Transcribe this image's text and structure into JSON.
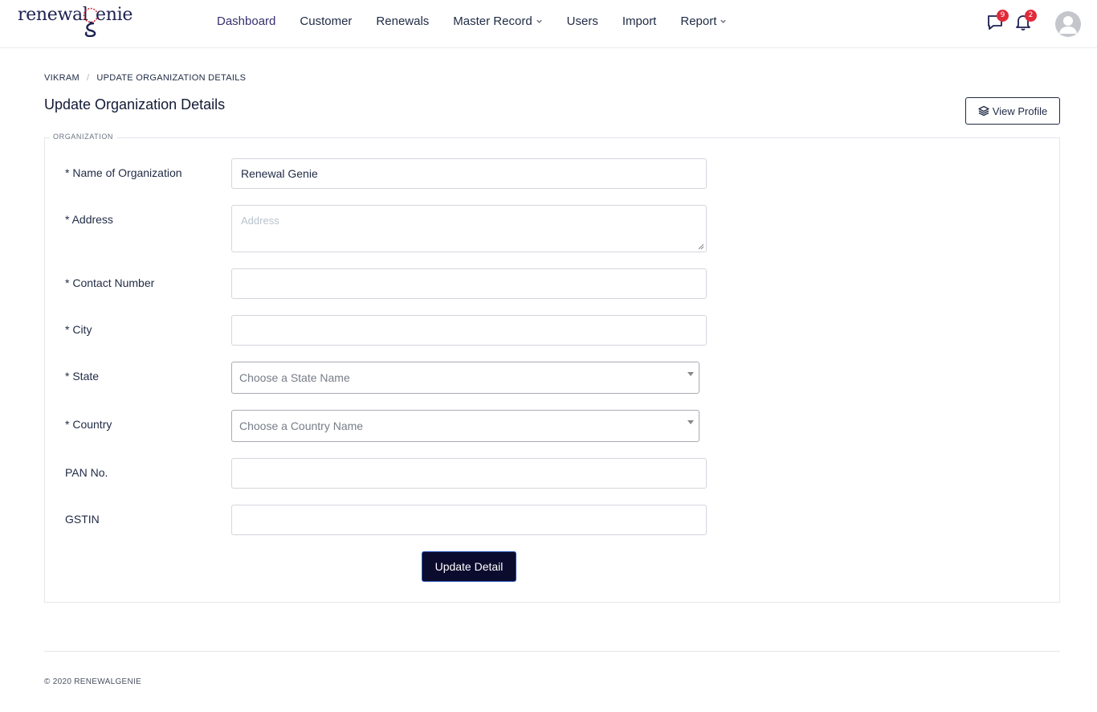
{
  "brand": {
    "logo_left": "renewal",
    "logo_right": "enie",
    "logo_icon": "genie-g-logo"
  },
  "nav": {
    "items": [
      {
        "label": "Dashboard",
        "active": true,
        "dropdown": false
      },
      {
        "label": "Customer",
        "active": false,
        "dropdown": false
      },
      {
        "label": "Renewals",
        "active": false,
        "dropdown": false
      },
      {
        "label": "Master Record",
        "active": false,
        "dropdown": true
      },
      {
        "label": "Users",
        "active": false,
        "dropdown": false
      },
      {
        "label": "Import",
        "active": false,
        "dropdown": false
      },
      {
        "label": "Report",
        "active": false,
        "dropdown": true
      }
    ]
  },
  "header": {
    "messages_count": "9",
    "notifications_count": "2",
    "badge_color": "#e02b3a"
  },
  "breadcrumb": {
    "items": [
      "VIKRAM",
      "UPDATE ORGANIZATION DETAILS"
    ],
    "separator": "/"
  },
  "page": {
    "title": "Update Organization Details",
    "view_profile_label": "View Profile"
  },
  "form": {
    "legend": "ORGANIZATION",
    "fields": {
      "name": {
        "label": "* Name of Organization",
        "value": "Renewal Genie"
      },
      "address": {
        "label": "* Address",
        "placeholder": "Address",
        "value": ""
      },
      "contact": {
        "label": "* Contact Number",
        "value": ""
      },
      "city": {
        "label": "* City",
        "value": ""
      },
      "state": {
        "label": "* State",
        "placeholder": "Choose a State Name"
      },
      "country": {
        "label": "* Country",
        "placeholder": "Choose a Country Name"
      },
      "pan": {
        "label": "PAN No.",
        "value": ""
      },
      "gstin": {
        "label": "GSTIN",
        "value": ""
      }
    },
    "submit_label": "Update Detail"
  },
  "footer": {
    "copyright": "© 2020 RENEWALGENIE"
  },
  "colors": {
    "brand_navy": "#1c2150",
    "button_dark": "#0b0b2e",
    "accent_red": "#c8323c"
  }
}
